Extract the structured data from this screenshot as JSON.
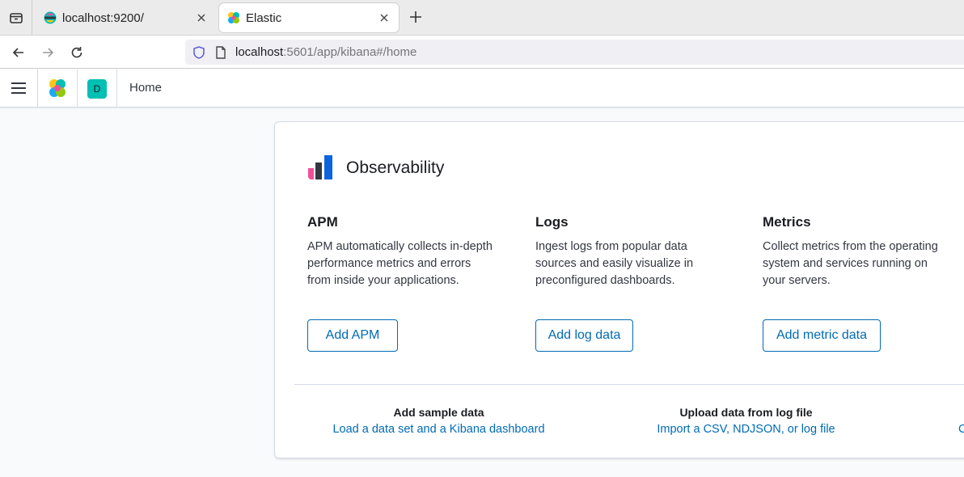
{
  "browser": {
    "tabs": [
      {
        "title": "localhost:9200/",
        "active": false
      },
      {
        "title": "Elastic",
        "active": true
      }
    ],
    "url_host": "localhost",
    "url_rest": ":5601/app/kibana#/home"
  },
  "kibana": {
    "space_initial": "D",
    "breadcrumb": "Home"
  },
  "panel": {
    "title": "Observability",
    "features": [
      {
        "title": "APM",
        "description": "APM automatically collects in-depth performance metrics and errors from inside your applications.",
        "button": "Add APM"
      },
      {
        "title": "Logs",
        "description": "Ingest logs from popular data sources and easily visualize in preconfigured dashboards.",
        "button": "Add log data"
      },
      {
        "title": "Metrics",
        "description": "Collect metrics from the operating system and services running on your servers.",
        "button": "Add metric data"
      }
    ],
    "footer": [
      {
        "title": "Add sample data",
        "link": "Load a data set and a Kibana dashboard"
      },
      {
        "title": "Upload data from log file",
        "link": "Import a CSV, NDJSON, or log file"
      }
    ],
    "footer_clipped_link": "C"
  },
  "colors": {
    "accent": "#006bb4",
    "space_avatar": "#00bfb3"
  }
}
